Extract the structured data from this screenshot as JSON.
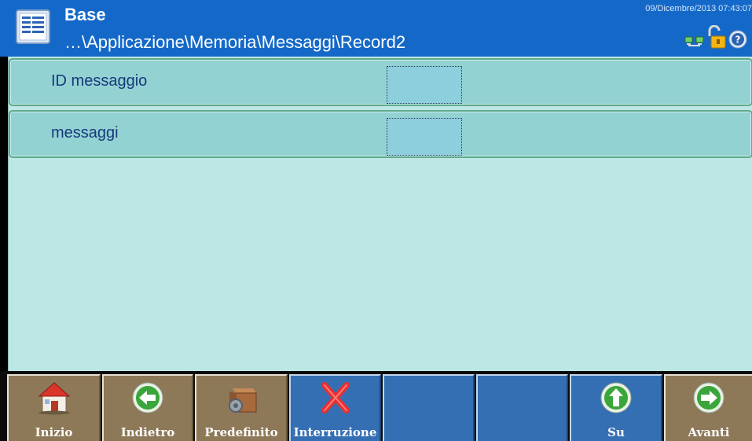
{
  "header": {
    "title": "Base",
    "path": "…\\Applicazione\\Memoria\\Messaggi\\Record2",
    "datetime": "09/Dicembre/2013 07:43:07",
    "app_icon": "document-list-icon",
    "status_icons": [
      "network-icon",
      "unlock-icon",
      "help-icon"
    ]
  },
  "rows": [
    {
      "label": "ID messaggio",
      "value": ""
    },
    {
      "label": "messaggi",
      "value": ""
    }
  ],
  "toolbar": {
    "keys": [
      {
        "label": "Inizio",
        "icon": "home-icon",
        "style": "brown"
      },
      {
        "label": "Indietro",
        "icon": "arrow-left-icon",
        "style": "brown"
      },
      {
        "label": "Predefinito",
        "icon": "box-gear-icon",
        "style": "brown"
      },
      {
        "label": "Interruzione",
        "icon": "red-x-icon",
        "style": "blue"
      },
      {
        "label": "",
        "icon": "",
        "style": "blue"
      },
      {
        "label": "",
        "icon": "",
        "style": "blue"
      },
      {
        "label": "Su",
        "icon": "arrow-up-icon",
        "style": "blue"
      },
      {
        "label": "Avanti",
        "icon": "arrow-right-icon",
        "style": "brown"
      }
    ]
  },
  "colors": {
    "header_bg": "#1469c8",
    "content_bg": "#bde7e5",
    "row_bg": "#93d2d3",
    "softkey_brown": "#8d7858",
    "softkey_blue": "#356fb3"
  }
}
